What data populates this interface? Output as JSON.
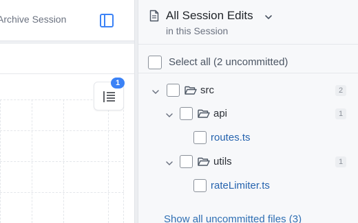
{
  "left_panel": {
    "archive_label": "Archive Session",
    "toggle_icon": "panel-left-icon",
    "outline_icon": "list-outline-icon",
    "badge_count": "1"
  },
  "right_panel": {
    "title": "All Session Edits",
    "subtitle": "in this Session",
    "select_all_label": "Select all (2 uncommitted)",
    "tree": [
      {
        "label": "src",
        "type": "folder",
        "count": "2"
      },
      {
        "label": "api",
        "type": "folder",
        "count": "1"
      },
      {
        "label": "routes.ts",
        "type": "file"
      },
      {
        "label": "utils",
        "type": "folder",
        "count": "1"
      },
      {
        "label": "rateLimiter.ts",
        "type": "file"
      }
    ],
    "show_all_label": "Show all uncommitted files (3)"
  },
  "colors": {
    "accent": "#3b82f6",
    "file_link": "#2563ae",
    "link": "#2f6fb3"
  }
}
